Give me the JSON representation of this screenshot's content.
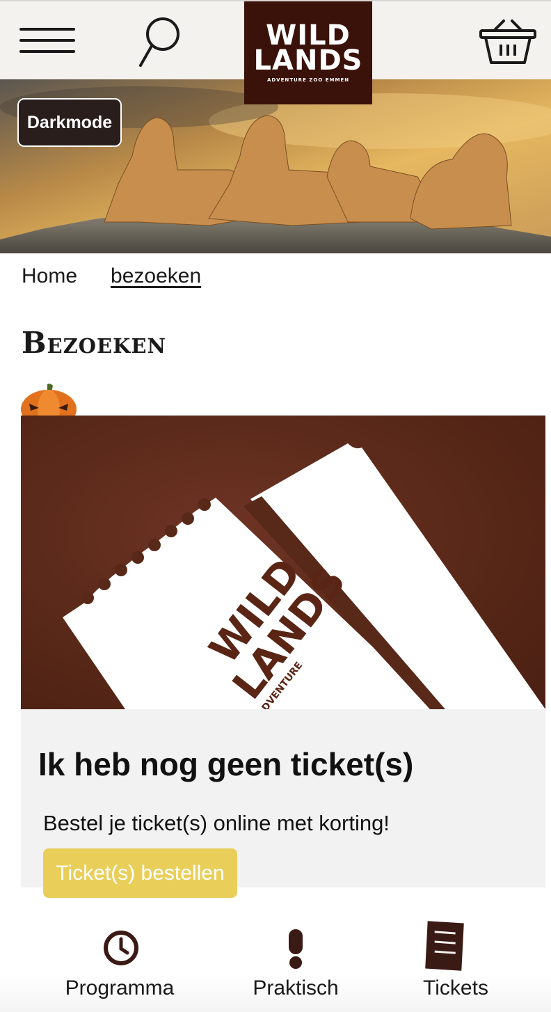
{
  "header": {
    "logo": {
      "line1": "WILD",
      "line2": "LANDS",
      "line3": "ADVENTURE ZOO EMMEN"
    },
    "icons": {
      "menu": "hamburger-menu-icon",
      "search": "search-icon",
      "cart": "basket-icon"
    }
  },
  "hero": {
    "darkmode_label": "Darkmode"
  },
  "breadcrumb": {
    "home": "Home",
    "current": "bezoeken"
  },
  "page": {
    "title": "Bezoeken"
  },
  "card": {
    "image_logo": {
      "line1": "WILD",
      "line2": "LANDS",
      "line3": "ADVENTURE"
    },
    "title": "Ik heb nog geen ticket(s)",
    "text": "Bestel je ticket(s) online met korting!",
    "button_label": "Ticket(s) bestellen"
  },
  "bottom_nav": {
    "items": [
      {
        "label": "Programma",
        "icon": "clock-icon"
      },
      {
        "label": "Praktisch",
        "icon": "exclamation-icon"
      },
      {
        "label": "Tickets",
        "icon": "ticket-icon"
      }
    ]
  },
  "colors": {
    "header_bg": "#f4f2ee",
    "logo_bg": "#3a1209",
    "card_bg": "#f2f2f2",
    "ticket_bg": "#582818",
    "button_bg": "#e9cf5a",
    "darkmode_bg": "#2a1e1c"
  }
}
